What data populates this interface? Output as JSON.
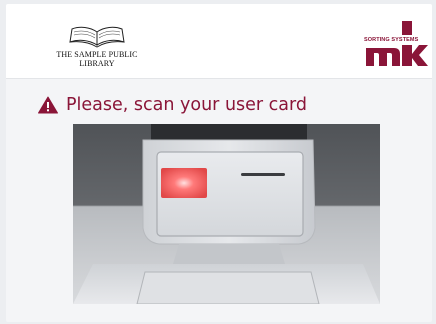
{
  "header": {
    "library_name_line1": "THE SAMPLE PUBLIC",
    "library_name_line2": "LIBRARY",
    "brand_tagline": "SORTING SYSTEMS",
    "brand_mark": "mk",
    "brand_color": "#8a1538"
  },
  "prompt": {
    "icon": "warning-icon",
    "text": "Please, scan your user card",
    "color": "#8a1538"
  },
  "illustration": {
    "icon": "card-scanner-kiosk-illustration",
    "reader_light_color": "#ff5a5a"
  }
}
